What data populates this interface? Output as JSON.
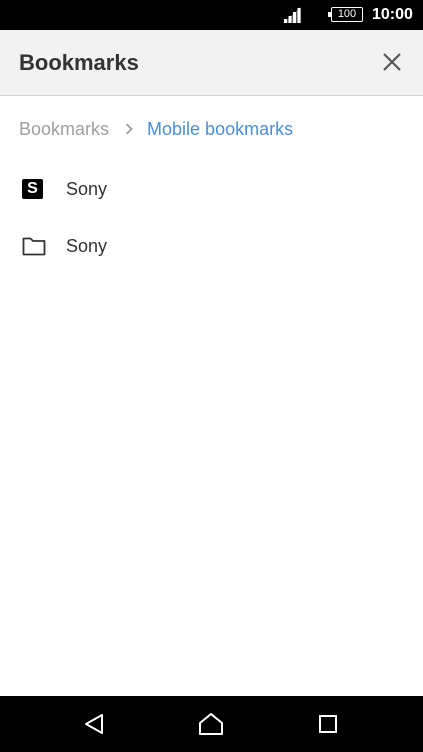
{
  "status_bar": {
    "battery": "100",
    "time": "10:00"
  },
  "app_bar": {
    "title": "Bookmarks"
  },
  "breadcrumb": {
    "root": "Bookmarks",
    "current": "Mobile bookmarks"
  },
  "items": [
    {
      "type": "bookmark",
      "icon": "sony-favicon",
      "favicon_letter": "S",
      "label": "Sony"
    },
    {
      "type": "folder",
      "icon": "folder-icon",
      "label": "Sony"
    }
  ],
  "nav_bar": {
    "buttons": [
      "back",
      "home",
      "recents"
    ]
  }
}
